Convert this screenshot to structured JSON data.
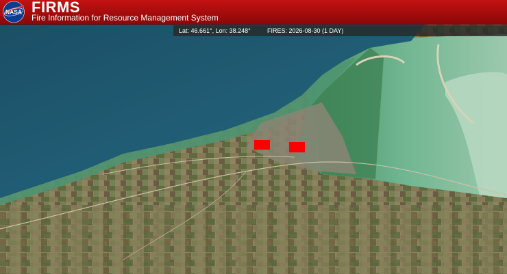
{
  "header": {
    "logo_text": "NASA",
    "title": "FIRMS",
    "subtitle": "Fire Information for Resource Management System"
  },
  "infobar": {
    "coordinates": "Lat: 46.661°, Lon: 38.248°",
    "fires_label": "FIRES: 2026-08-30 (1 DAY)"
  },
  "map": {
    "layer": "satellite-imagery",
    "colors": {
      "sea": "#1f5a70",
      "lagoon": "#5faa8a",
      "land": "#6b6a45",
      "fire_marker": "#ff0000",
      "header_red": "#b00f0f"
    },
    "fire_detections": [
      {
        "lat": 46.652,
        "lon": 38.191
      },
      {
        "lat": 46.651,
        "lon": 38.263
      }
    ]
  }
}
